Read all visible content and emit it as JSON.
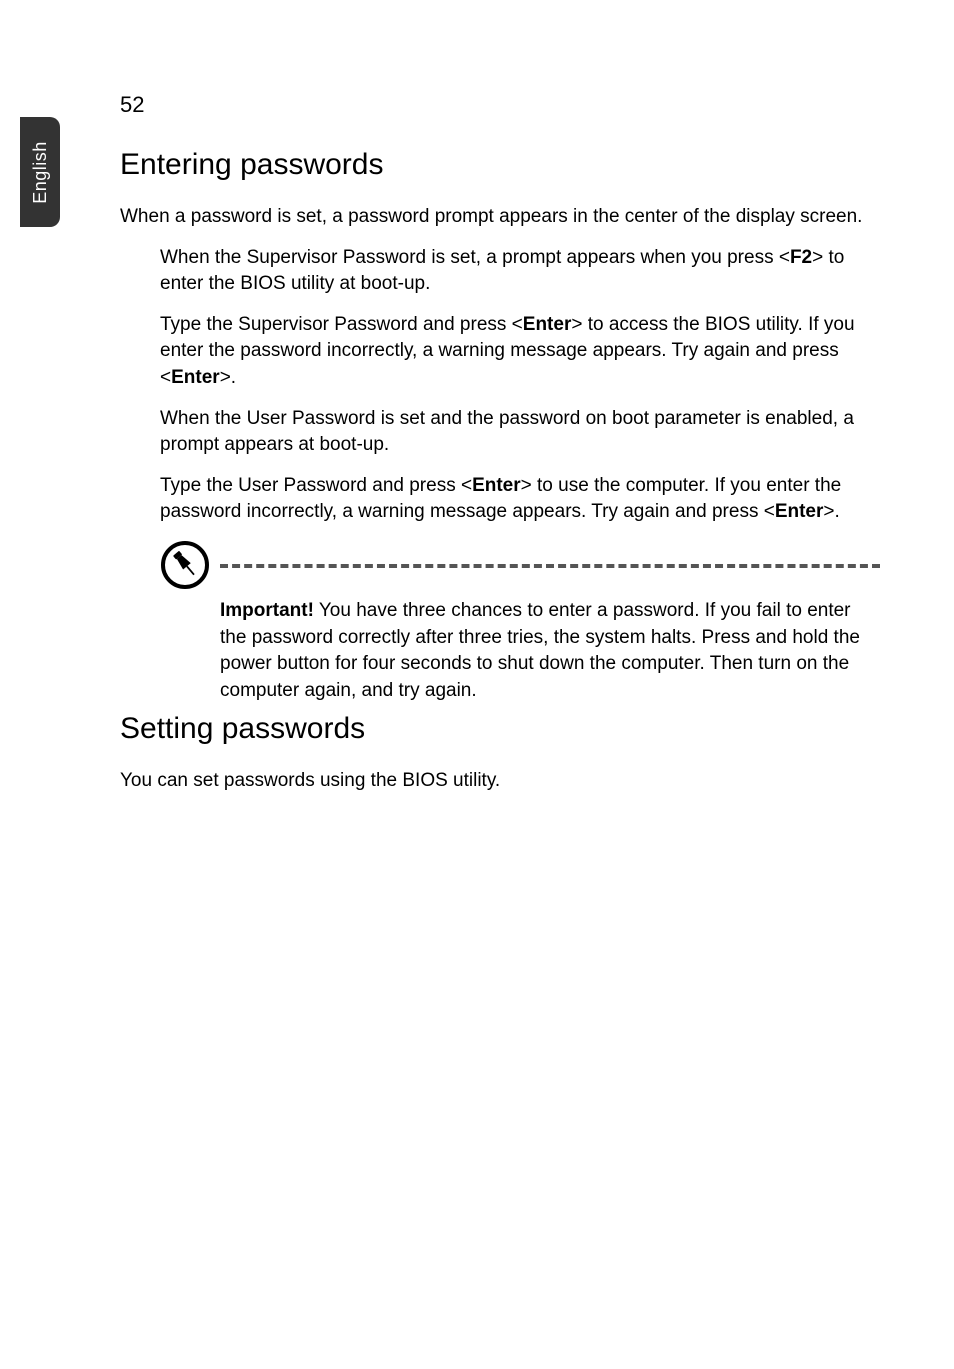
{
  "sideTab": "English",
  "pageNumber": "52",
  "section1": {
    "title": "Entering passwords",
    "intro": "When a password is set, a password prompt appears in the center of the display screen.",
    "bullets": [
      {
        "pre": "When the Supervisor Password is set, a prompt appears when you press <",
        "k1": "F2",
        "post": "> to enter the BIOS utility at boot-up."
      },
      {
        "pre": "Type the Supervisor Password and press <",
        "k1": "Enter",
        "mid": "> to access the BIOS utility. If you enter the password incorrectly, a warning message appears. Try again and press <",
        "k2": "Enter",
        "post": ">."
      },
      {
        "pre": "When the User Password is set and the password on boot parameter is enabled, a prompt appears at boot-up."
      },
      {
        "pre": "Type the User Password and press <",
        "k1": "Enter",
        "mid": "> to use the computer. If you enter the password incorrectly, a warning message appears. Try again and press <",
        "k2": "Enter",
        "post": ">."
      }
    ],
    "note": {
      "label": "Important!",
      "text": " You have three chances to enter a password. If you fail to enter the password correctly after three tries, the system halts. Press and hold the power button for four seconds to shut down the computer. Then turn on the computer again, and try again."
    }
  },
  "section2": {
    "title": "Setting passwords",
    "body": "You can set passwords using the BIOS utility."
  }
}
